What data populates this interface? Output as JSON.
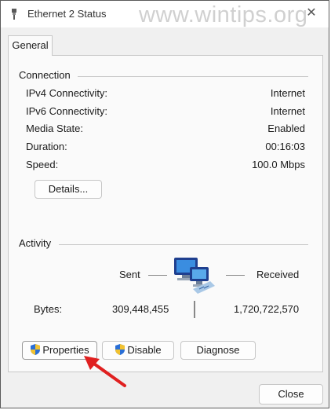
{
  "window": {
    "title": "Ethernet 2 Status",
    "watermark": "www.wintips.org",
    "close_glyph": "✕"
  },
  "tabs": [
    {
      "label": "General",
      "selected": true
    }
  ],
  "connection": {
    "heading": "Connection",
    "rows": [
      {
        "label": "IPv4 Connectivity:",
        "value": "Internet"
      },
      {
        "label": "IPv6 Connectivity:",
        "value": "Internet"
      },
      {
        "label": "Media State:",
        "value": "Enabled"
      },
      {
        "label": "Duration:",
        "value": "00:16:03"
      },
      {
        "label": "Speed:",
        "value": "100.0 Mbps"
      }
    ],
    "details_label": "Details..."
  },
  "activity": {
    "heading": "Activity",
    "sent_label": "Sent",
    "received_label": "Received",
    "bytes_label": "Bytes:",
    "sent_bytes": "309,448,455",
    "received_bytes": "1,720,722,570"
  },
  "buttons": {
    "properties": "Properties",
    "disable": "Disable",
    "diagnose": "Diagnose",
    "close": "Close"
  },
  "icons": {
    "title": "network-adapter-icon",
    "activity": "network-computers-icon",
    "shield": "uac-shield-icon",
    "annotation": "red-arrow-annotation"
  },
  "colors": {
    "accent_arrow": "#e02020",
    "shield_blue": "#2a6fd6",
    "shield_yellow": "#f2c230"
  }
}
